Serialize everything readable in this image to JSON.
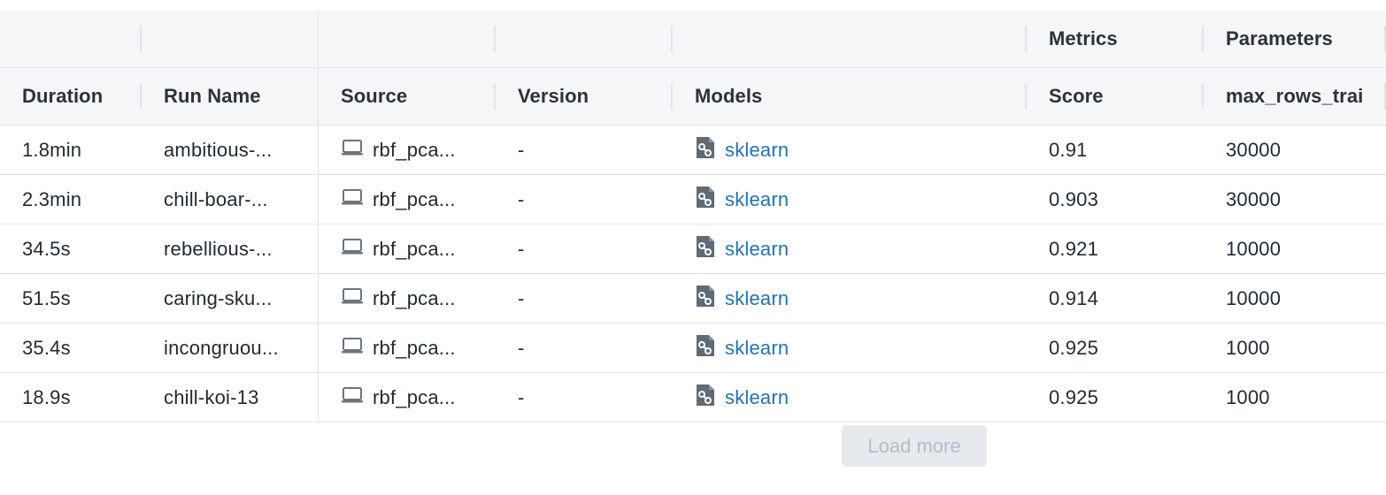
{
  "group_headers": [
    "",
    "",
    "",
    "",
    "",
    "Metrics",
    "Parameters"
  ],
  "columns": [
    "Duration",
    "Run Name",
    "Source",
    "Version",
    "Models",
    "Score",
    "max_rows_trai"
  ],
  "rows": [
    {
      "duration": "1.8min",
      "run_name": "ambitious-...",
      "source": "rbf_pca...",
      "version": "-",
      "model": "sklearn",
      "score": "0.91",
      "max_rows": "30000"
    },
    {
      "duration": "2.3min",
      "run_name": "chill-boar-...",
      "source": "rbf_pca...",
      "version": "-",
      "model": "sklearn",
      "score": "0.903",
      "max_rows": "30000"
    },
    {
      "duration": "34.5s",
      "run_name": "rebellious-...",
      "source": "rbf_pca...",
      "version": "-",
      "model": "sklearn",
      "score": "0.921",
      "max_rows": "10000"
    },
    {
      "duration": "51.5s",
      "run_name": "caring-sku...",
      "source": "rbf_pca...",
      "version": "-",
      "model": "sklearn",
      "score": "0.914",
      "max_rows": "10000"
    },
    {
      "duration": "35.4s",
      "run_name": "incongruou...",
      "source": "rbf_pca...",
      "version": "-",
      "model": "sklearn",
      "score": "0.925",
      "max_rows": "1000"
    },
    {
      "duration": "18.9s",
      "run_name": "chill-koi-13",
      "source": "rbf_pca...",
      "version": "-",
      "model": "sklearn",
      "score": "0.925",
      "max_rows": "1000"
    }
  ],
  "icons": {
    "source": "laptop-icon",
    "model": "model-file-icon"
  },
  "colors": {
    "link": "#2272b4",
    "header_bg": "#f5f6f7",
    "border": "#e1e4e8"
  },
  "load_more_label": "Load more"
}
